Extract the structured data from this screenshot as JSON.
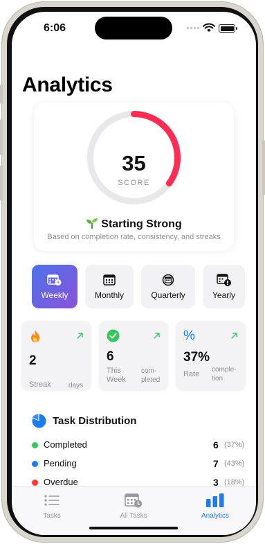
{
  "status": {
    "time": "6:06"
  },
  "page": {
    "title": "Analytics"
  },
  "score": {
    "value": "35",
    "label": "SCORE",
    "progress": 0.35,
    "ring_color": "#ff2d55",
    "level": "Starting Strong",
    "level_icon": "sprout-icon",
    "description": "Based on completion rate, consistency, and streaks"
  },
  "periods": [
    {
      "label": "Weekly",
      "icon": "calendar-week-icon",
      "active": true
    },
    {
      "label": "Monthly",
      "icon": "calendar-month-icon",
      "active": false
    },
    {
      "label": "Quarterly",
      "icon": "calendar-quarter-icon",
      "active": false
    },
    {
      "label": "Yearly",
      "icon": "calendar-year-icon",
      "active": false
    }
  ],
  "stats": {
    "streak": {
      "value": "2",
      "label": "Streak",
      "unit": "days",
      "icon": "flame-icon"
    },
    "week": {
      "value": "6",
      "label_line1": "This",
      "label_line2": "Week",
      "unit_line1": "com-",
      "unit_line2": "pleted",
      "icon": "checkmark-circle-icon"
    },
    "rate": {
      "value": "37%",
      "label": "Rate",
      "unit_line1": "comple-",
      "unit_line2": "tion",
      "icon": "percent-icon"
    }
  },
  "distribution": {
    "title": "Task Distribution",
    "items": [
      {
        "name": "Completed",
        "count": "6",
        "percent": "(37%)",
        "color": "#34c759"
      },
      {
        "name": "Pending",
        "count": "7",
        "percent": "(43%)",
        "color": "#1e7cf2"
      },
      {
        "name": "Overdue",
        "count": "3",
        "percent": "(18%)",
        "color": "#ff3b30"
      }
    ]
  },
  "tabs": [
    {
      "label": "Tasks",
      "icon": "list-icon",
      "active": false
    },
    {
      "label": "All Tasks",
      "icon": "calendar-clock-icon",
      "active": false
    },
    {
      "label": "Analytics",
      "icon": "bar-chart-icon",
      "active": true
    }
  ],
  "colors": {
    "accent": "#1e7cf2",
    "gradient_start": "#4a72ea",
    "gradient_end": "#8a52d8"
  }
}
